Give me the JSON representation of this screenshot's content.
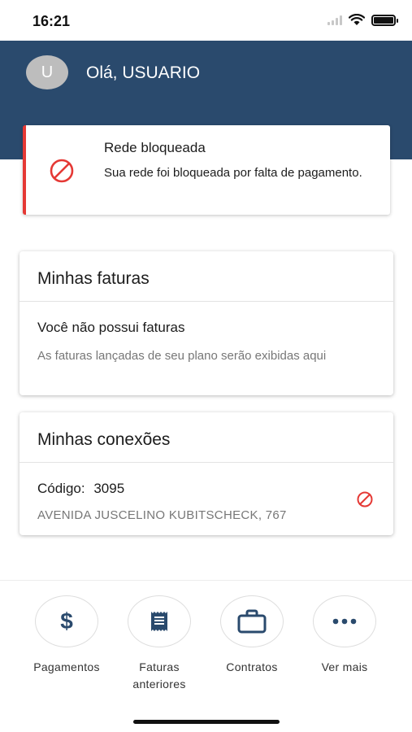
{
  "status_bar": {
    "time": "16:21"
  },
  "header": {
    "avatar_letter": "U",
    "greeting": "Olá, USUARIO"
  },
  "alert": {
    "title": "Rede bloqueada",
    "message": "Sua rede foi bloqueada por falta de pagamento.",
    "icon": "blocked-icon",
    "color": "#e53935"
  },
  "invoices": {
    "title": "Minhas faturas",
    "empty_title": "Você não possui faturas",
    "empty_description": "As faturas lançadas de seu plano serão exibidas aqui"
  },
  "connections": {
    "title": "Minhas conexões",
    "code_label": "Código:",
    "code_value": "3095",
    "address": "AVENIDA JUSCELINO KUBITSCHECK, 767",
    "status_icon": "blocked-icon"
  },
  "nav": {
    "items": [
      {
        "label": "Pagamentos",
        "icon": "dollar-icon"
      },
      {
        "label": "Faturas anteriores",
        "icon": "receipt-icon"
      },
      {
        "label": "Contratos",
        "icon": "briefcase-icon"
      },
      {
        "label": "Ver mais",
        "icon": "more-icon"
      }
    ]
  },
  "colors": {
    "primary": "#2a4a6d",
    "danger": "#e53935"
  }
}
